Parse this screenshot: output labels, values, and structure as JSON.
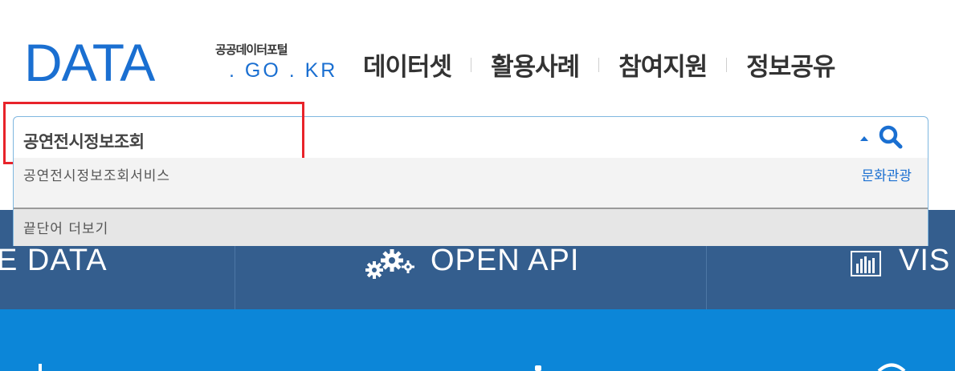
{
  "logo": {
    "main": "DATA",
    "subtitle": "공공데이터포털",
    "domain": ". GO . KR"
  },
  "gnb": [
    "데이터셋",
    "활용사례",
    "참여지원",
    "정보공유"
  ],
  "search": {
    "value": "공연전시정보조회"
  },
  "dropdown": {
    "suggestion": {
      "name": "공연전시정보조회서비스",
      "category": "문화관광"
    },
    "more_label": "끝단어 더보기"
  },
  "menu_band": {
    "items": [
      {
        "label": "E DATA"
      },
      {
        "label": "OPEN API"
      },
      {
        "label": "VIS"
      }
    ]
  },
  "colors": {
    "brand_blue": "#1a6fd1",
    "menu_bg": "#345e8e",
    "bottom_bg": "#0c86d8",
    "highlight_red": "#e8232a"
  },
  "icons": [
    "search-icon",
    "caret-up-icon",
    "gears-icon",
    "chart-icon"
  ]
}
